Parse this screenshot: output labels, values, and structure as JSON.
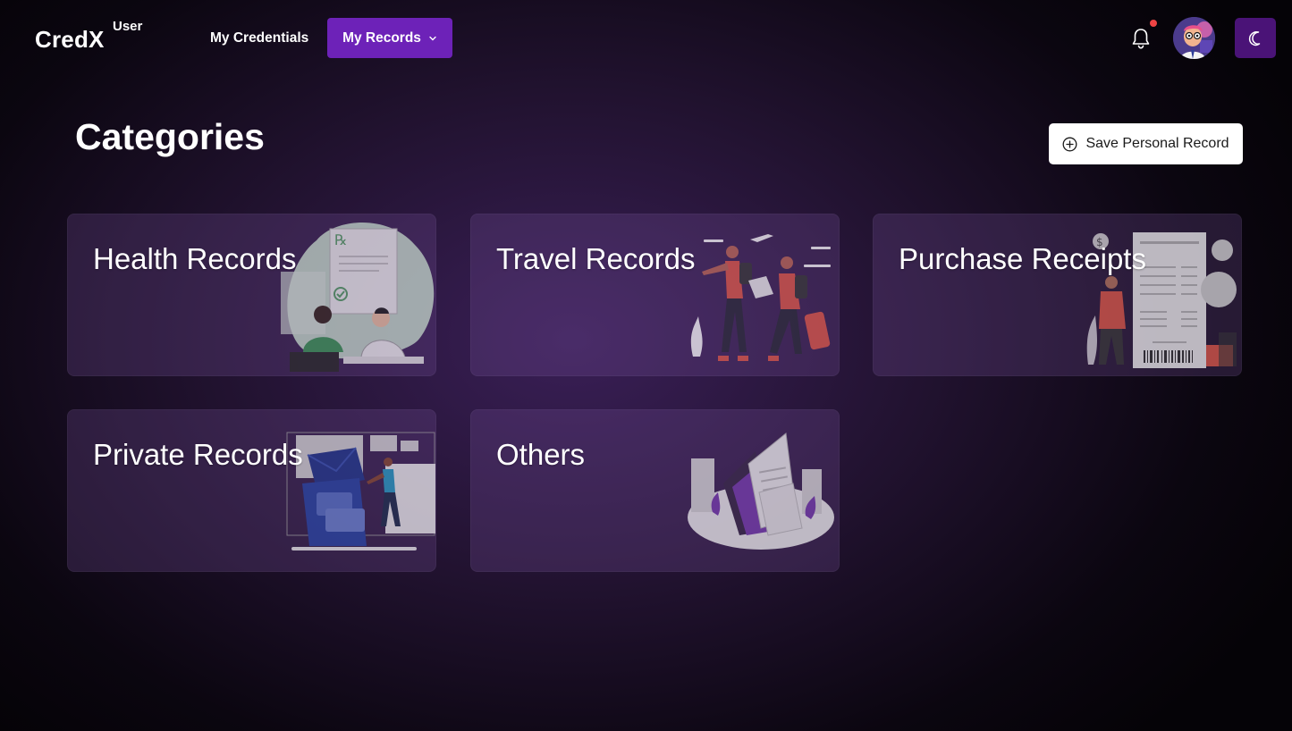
{
  "header": {
    "brand": "CredX",
    "brand_sub": "User",
    "nav": {
      "credentials_label": "My Credentials",
      "records_label": "My Records"
    },
    "icons": [
      "bell-icon",
      "avatar",
      "moon-icon",
      "chevron-down-icon"
    ],
    "notification_dot": true
  },
  "main": {
    "title": "Categories",
    "save_button_label": "Save Personal Record",
    "categories": [
      {
        "label": "Health Records"
      },
      {
        "label": "Travel Records"
      },
      {
        "label": "Purchase Receipts"
      },
      {
        "label": "Private Records"
      },
      {
        "label": "Others"
      }
    ]
  },
  "colors": {
    "accent": "#6d22b8",
    "theme_button": "#4a1377",
    "notification": "#ef4444"
  }
}
